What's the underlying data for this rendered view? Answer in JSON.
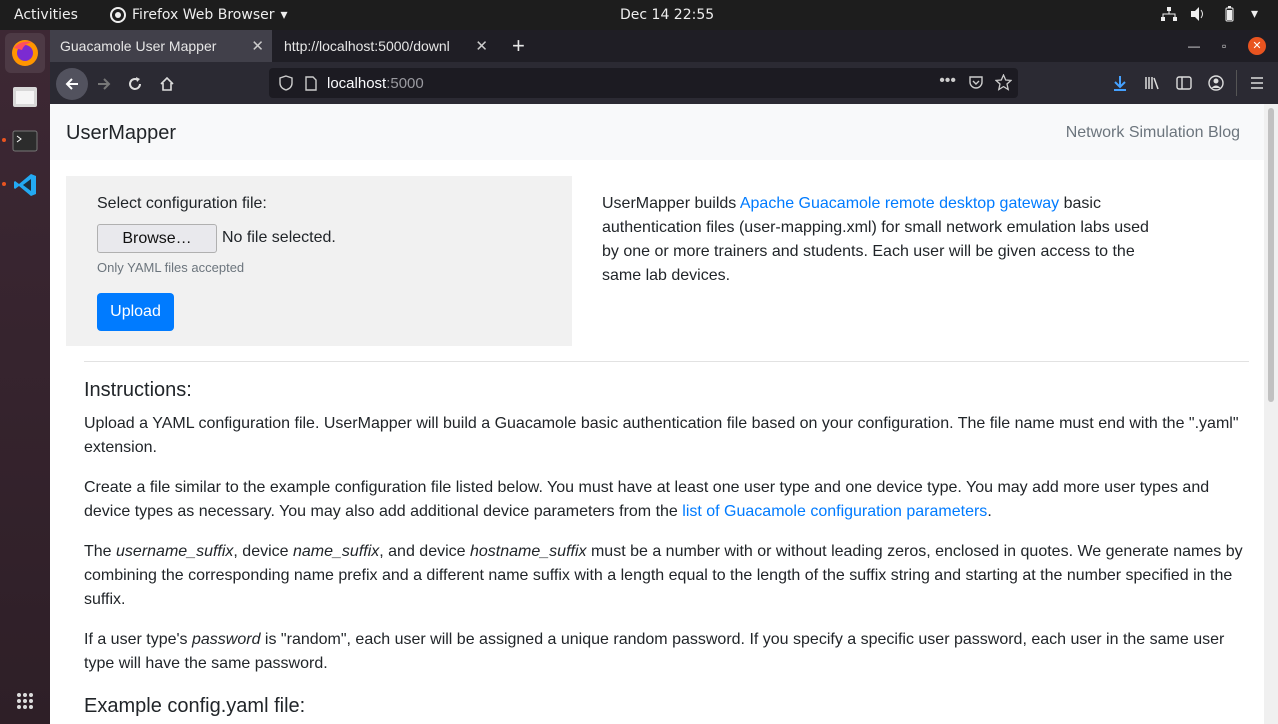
{
  "system": {
    "activities": "Activities",
    "app_name": "Firefox Web Browser",
    "clock": "Dec 14  22:55"
  },
  "tabs": [
    {
      "label": "Guacamole User Mapper",
      "active": true
    },
    {
      "label": "http://localhost:5000/downl",
      "active": false
    }
  ],
  "urlbar": {
    "host": "localhost",
    "port": ":5000"
  },
  "page": {
    "brand": "UserMapper",
    "nav_link": "Network Simulation Blog",
    "form": {
      "label": "Select configuration file:",
      "browse": "Browse…",
      "no_file": "No file selected.",
      "help": "Only YAML files accepted",
      "upload": "Upload"
    },
    "intro": {
      "pre": "UserMapper builds ",
      "link": "Apache Guacamole remote desktop gateway",
      "post": " basic authentication files (user-mapping.xml) for small network emulation labs used by one or more trainers and students. Each user will be given access to the same lab devices."
    },
    "instructions_heading": "Instructions:",
    "p1": "Upload a YAML configuration file. UserMapper will build a Guacamole basic authentication file based on your configuration. The file name must end with the \".yaml\" extension.",
    "p2_pre": "Create a file similar to the example configuration file listed below. You must have at least one user type and one device type. You may add more user types and device types as necessary. You may also add additional device parameters from the ",
    "p2_link": "list of Guacamole configuration parameters",
    "p2_post": ".",
    "p3": {
      "t1": "The ",
      "e1": "username_suffix",
      "t2": ", device ",
      "e2": "name_suffix",
      "t3": ", and device ",
      "e3": "hostname_suffix",
      "t4": " must be a number with or without leading zeros, enclosed in quotes. We generate names by combining the corresponding name prefix and a different name suffix with a length equal to the length of the suffix string and starting at the number specified in the suffix."
    },
    "p4": {
      "t1": "If a user type's ",
      "e1": "password",
      "t2": " is \"random\", each user will be assigned a unique random password. If you specify a specific user password, each user in the same user type will have the same password."
    },
    "example_heading": "Example config.yaml file:"
  }
}
